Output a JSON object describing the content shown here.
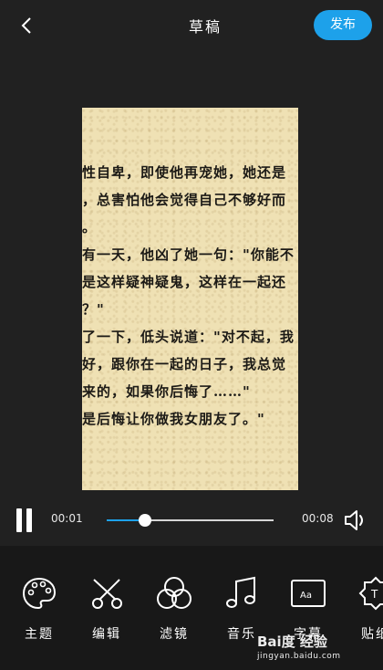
{
  "header": {
    "title": "草稿",
    "publish_label": "发布"
  },
  "preview": {
    "lines": [
      "性自卑，即使他再宠她，她还是",
      "，总害怕他会觉得自己不够好而",
      "。",
      "有一天，他凶了她一句：\"你能不",
      "是这样疑神疑鬼，这样在一起还",
      "？\"",
      "了一下，低头说道：\"对不起，我",
      "好，跟你在一起的日子，我总觉",
      "来的，如果你后悔了……\"",
      "是后悔让你做我女朋友了。\""
    ]
  },
  "player": {
    "current_time": "00:01",
    "total_time": "00:08",
    "progress": 0.23
  },
  "toolbar": {
    "items": [
      {
        "label": "主题",
        "icon": "palette-icon"
      },
      {
        "label": "编辑",
        "icon": "scissors-icon"
      },
      {
        "label": "滤镜",
        "icon": "filter-circles-icon"
      },
      {
        "label": "音乐",
        "icon": "music-note-icon"
      },
      {
        "label": "字幕",
        "icon": "caption-aa-icon"
      },
      {
        "label": "贴纸",
        "icon": "sticker-icon"
      }
    ]
  },
  "watermark": {
    "logo_text": "Bai度 经验",
    "url": "jingyan.baidu.com"
  },
  "colors": {
    "accent": "#1da1ea",
    "background": "#212121",
    "toolbar_bg": "#181818",
    "paper": "#efe1b4"
  }
}
